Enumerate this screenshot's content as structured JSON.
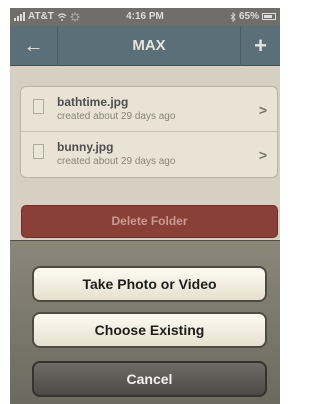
{
  "status_bar": {
    "carrier": "AT&T",
    "time": "4:16 PM",
    "battery": "65%"
  },
  "nav": {
    "back_label": "←",
    "title": "MAX",
    "add_label": "+"
  },
  "files": [
    {
      "name": "bathtime.jpg",
      "subtitle": "created about 29 days ago"
    },
    {
      "name": "bunny.jpg",
      "subtitle": "created about 29 days ago"
    }
  ],
  "delete_label": "Delete Folder",
  "action_sheet": {
    "take_photo_label": "Take Photo or Video",
    "choose_existing_label": "Choose Existing",
    "cancel_label": "Cancel"
  },
  "colors": {
    "nav_bar": "#5a6f78",
    "delete_button": "#8a3f37",
    "sheet_background": "#7a776b"
  },
  "icons": [
    "signal-icon",
    "wifi-icon",
    "activity-spinner-icon",
    "bluetooth-icon",
    "battery-icon",
    "back-arrow-icon",
    "plus-icon",
    "file-icon",
    "chevron-right-icon"
  ]
}
